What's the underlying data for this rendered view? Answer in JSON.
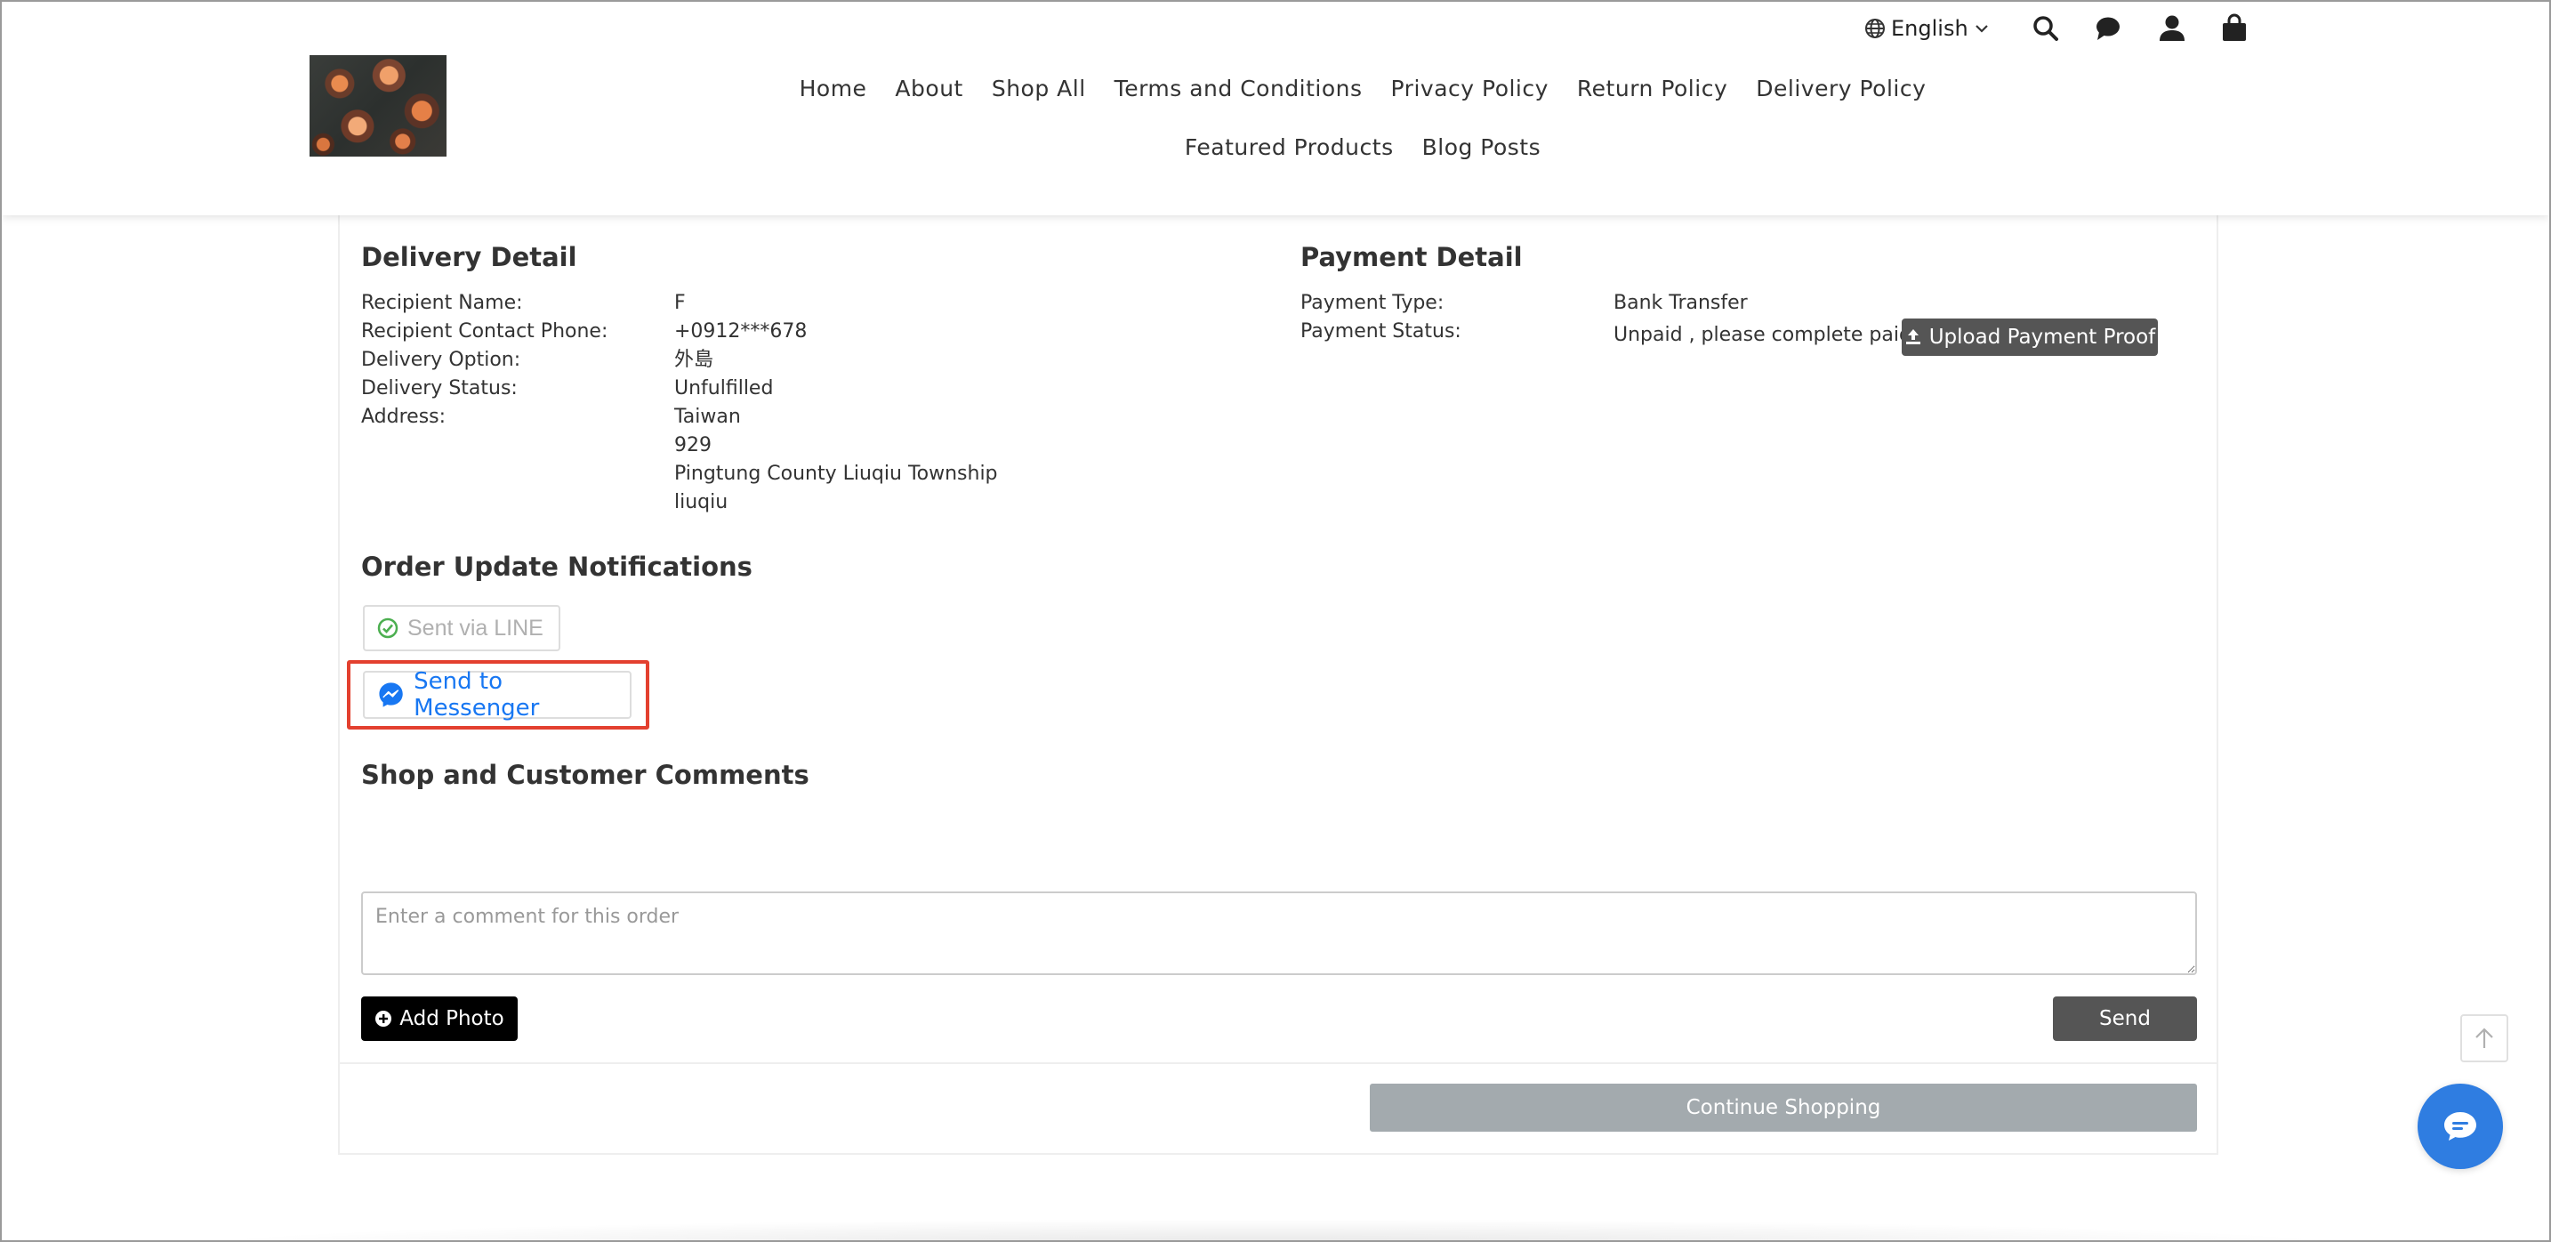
{
  "header": {
    "language_label": "English",
    "nav": [
      "Home",
      "About",
      "Shop All",
      "Terms and Conditions",
      "Privacy Policy",
      "Return Policy",
      "Delivery Policy",
      "Featured Products",
      "Blog Posts"
    ],
    "icons": [
      "globe-icon",
      "chevron-down-icon",
      "search-icon",
      "chat-bubble-icon",
      "account-icon",
      "cart-icon"
    ]
  },
  "delivery": {
    "title": "Delivery Detail",
    "recipient_name_label": "Recipient Name:",
    "recipient_name": "F",
    "phone_label": "Recipient Contact Phone:",
    "phone": "+0912***678",
    "option_label": "Delivery Option:",
    "option": "外島",
    "status_label": "Delivery Status:",
    "status": "Unfulfilled",
    "address_label": "Address:",
    "address_lines": [
      "Taiwan",
      "929",
      "Pingtung County Liuqiu Township",
      "liuqiu"
    ]
  },
  "payment": {
    "title": "Payment Detail",
    "type_label": "Payment Type:",
    "type": "Bank Transfer",
    "status_label": "Payment Status:",
    "status": "Unpaid , please complete paid",
    "upload_label": "Upload Payment Proof"
  },
  "notifications": {
    "title": "Order Update Notifications",
    "line_label": "Sent via LINE",
    "messenger_label": "Send to Messenger"
  },
  "comments": {
    "title": "Shop and Customer Comments",
    "placeholder": "Enter a comment for this order",
    "add_photo_label": "Add Photo",
    "send_label": "Send"
  },
  "continue_label": "Continue Shopping",
  "colors": {
    "messenger_blue": "#1877f2",
    "highlight_red": "#e3402f",
    "line_green": "#4caf50",
    "dark_button": "#555555",
    "fab_blue": "#2f7de1"
  }
}
